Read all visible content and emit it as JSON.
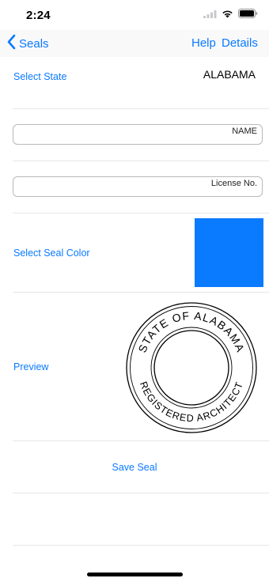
{
  "status": {
    "time": "2:24"
  },
  "nav": {
    "back_label": "Seals",
    "help_label": "Help",
    "details_label": "Details"
  },
  "form": {
    "select_state_label": "Select State",
    "state_value": "ALABAMA",
    "name_placeholder": "NAME",
    "license_placeholder": "License No.",
    "seal_color_label": "Select Seal Color",
    "seal_color": "#0a7aff",
    "preview_label": "Preview",
    "save_label": "Save Seal"
  },
  "seal": {
    "top_text": "STATE OF ALABAMA",
    "bottom_text": "REGISTERED ARCHITECT"
  }
}
